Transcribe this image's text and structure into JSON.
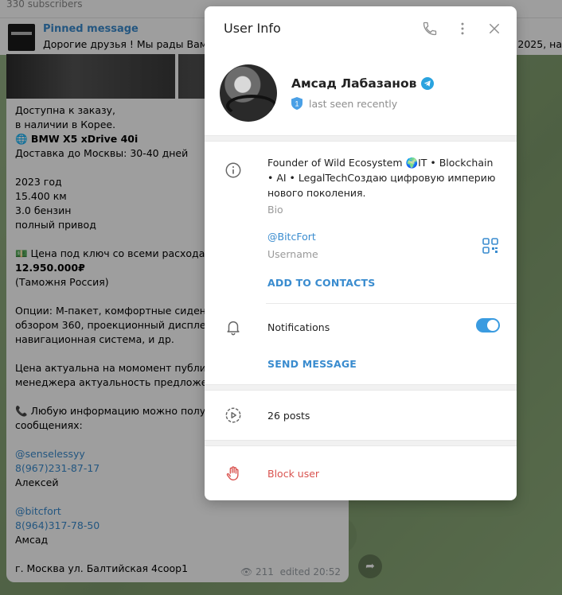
{
  "background": {
    "subscribers": "330 subscribers",
    "pinned": {
      "title": "Pinned message",
      "text": "Дорогие друзья !  Мы рады Вам с",
      "text_right": "3 2025, на"
    },
    "message": {
      "lines": [
        "Доступна к заказу,",
        "в наличии в Корее.",
        "🌐 BMW X5 xDrive 40i",
        "Доставка до Москвы: 30-40 дней",
        "",
        "2023 год",
        "15.400 км",
        "3.0 бензин",
        "полный привод",
        "",
        "💵 Цена под ключ со всеми расходами",
        "12.950.000₽",
        "(Таможня Россия)",
        "",
        "Опции: М-пакет, комфортные сидения,",
        "обзором 360, проекционный дисплей,",
        "навигационная система, и др.",
        "",
        "Цена актуальна на момомент публика",
        "менеджера актуальность предложени",
        "",
        "📞 Любую информацию можно полу",
        "сообщениях:",
        "",
        "@senselessyy",
        "8(967)231-87-17",
        "Алексей",
        "",
        "@bitcfort",
        "8(964)317-78-50",
        "Амсад",
        "",
        "г. Москва ул. Балтийская 4соор1"
      ],
      "views": "211",
      "edited": "edited 20:52"
    }
  },
  "modal": {
    "title": "User Info",
    "icons": {
      "call": "phone-icon",
      "more": "more-vertical-icon",
      "close": "close-icon"
    },
    "user": {
      "name": "Амсад Лабазанов",
      "status": "last seen recently",
      "badge_level": "1"
    },
    "bio": {
      "text": "Founder of Wild Ecosystem 🌍IT • Blockchain • AI • LegalTechСоздаю цифровую империю нового поколения.",
      "caption": "Bio"
    },
    "username": {
      "value": "@BitcFort",
      "caption": "Username"
    },
    "add_contacts": "ADD TO CONTACTS",
    "notifications": {
      "label": "Notifications",
      "enabled": true
    },
    "send_message": "SEND MESSAGE",
    "posts": "26 posts",
    "block": "Block user"
  },
  "colors": {
    "accent": "#3a8ccf",
    "danger": "#d9534f",
    "toggle": "#3a9be0"
  }
}
